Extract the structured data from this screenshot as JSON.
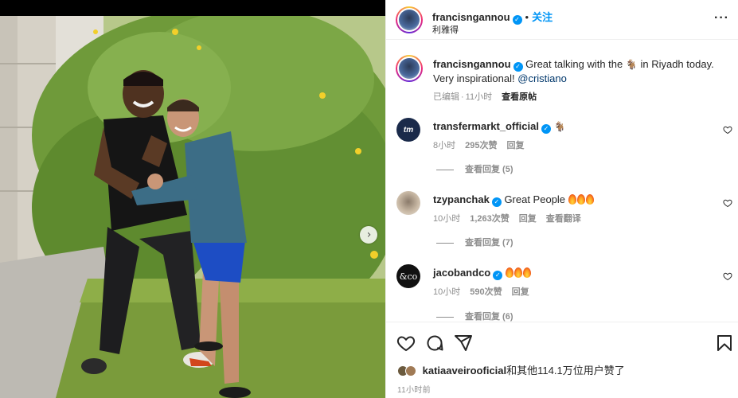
{
  "post": {
    "username": "francisngannou",
    "verified": true,
    "follow_label": "关注",
    "header_dot": "•",
    "location_sub": "利雅得",
    "more_label": "···"
  },
  "caption": {
    "username": "francisngannou",
    "text_before": "Great talking with the",
    "emoji": "🐐",
    "text_after": "in Riyadh today. Very inspirational!",
    "mention": "@cristiano",
    "meta_edited": "已编辑",
    "meta_sep": "·",
    "meta_time": "11小时",
    "meta_view_original": "查看原帖"
  },
  "comments": [
    {
      "username": "transfermarkt_official",
      "avatar_text": "tm",
      "text": "🐐",
      "time": "8小时",
      "likes": "295次赞",
      "reply": "回复",
      "view_replies": "查看回复 (5)"
    },
    {
      "username": "tzypanchak",
      "text": "Great People",
      "fire_count": 3,
      "time": "10小时",
      "likes": "1,263次赞",
      "reply": "回复",
      "translate": "查看翻译",
      "view_replies": "查看回复 (7)"
    },
    {
      "username": "jacobandco",
      "avatar_text": "&co",
      "fire_count": 3,
      "time": "10小时",
      "likes": "590次赞",
      "reply": "回复",
      "view_replies": "查看回复 (6)"
    }
  ],
  "likes_row": {
    "liker": "katiaaveirooficial",
    "rest": "和其他114.1万位用户赞了"
  },
  "post_time": "11小时前",
  "colors": {
    "accent": "#0095f6",
    "text": "#262626",
    "muted": "#8e8e8e",
    "border": "#efefef"
  },
  "icons": [
    "heart-icon",
    "comment-icon",
    "share-icon",
    "bookmark-icon",
    "more-icon",
    "chevron-right-icon",
    "verified-icon"
  ]
}
